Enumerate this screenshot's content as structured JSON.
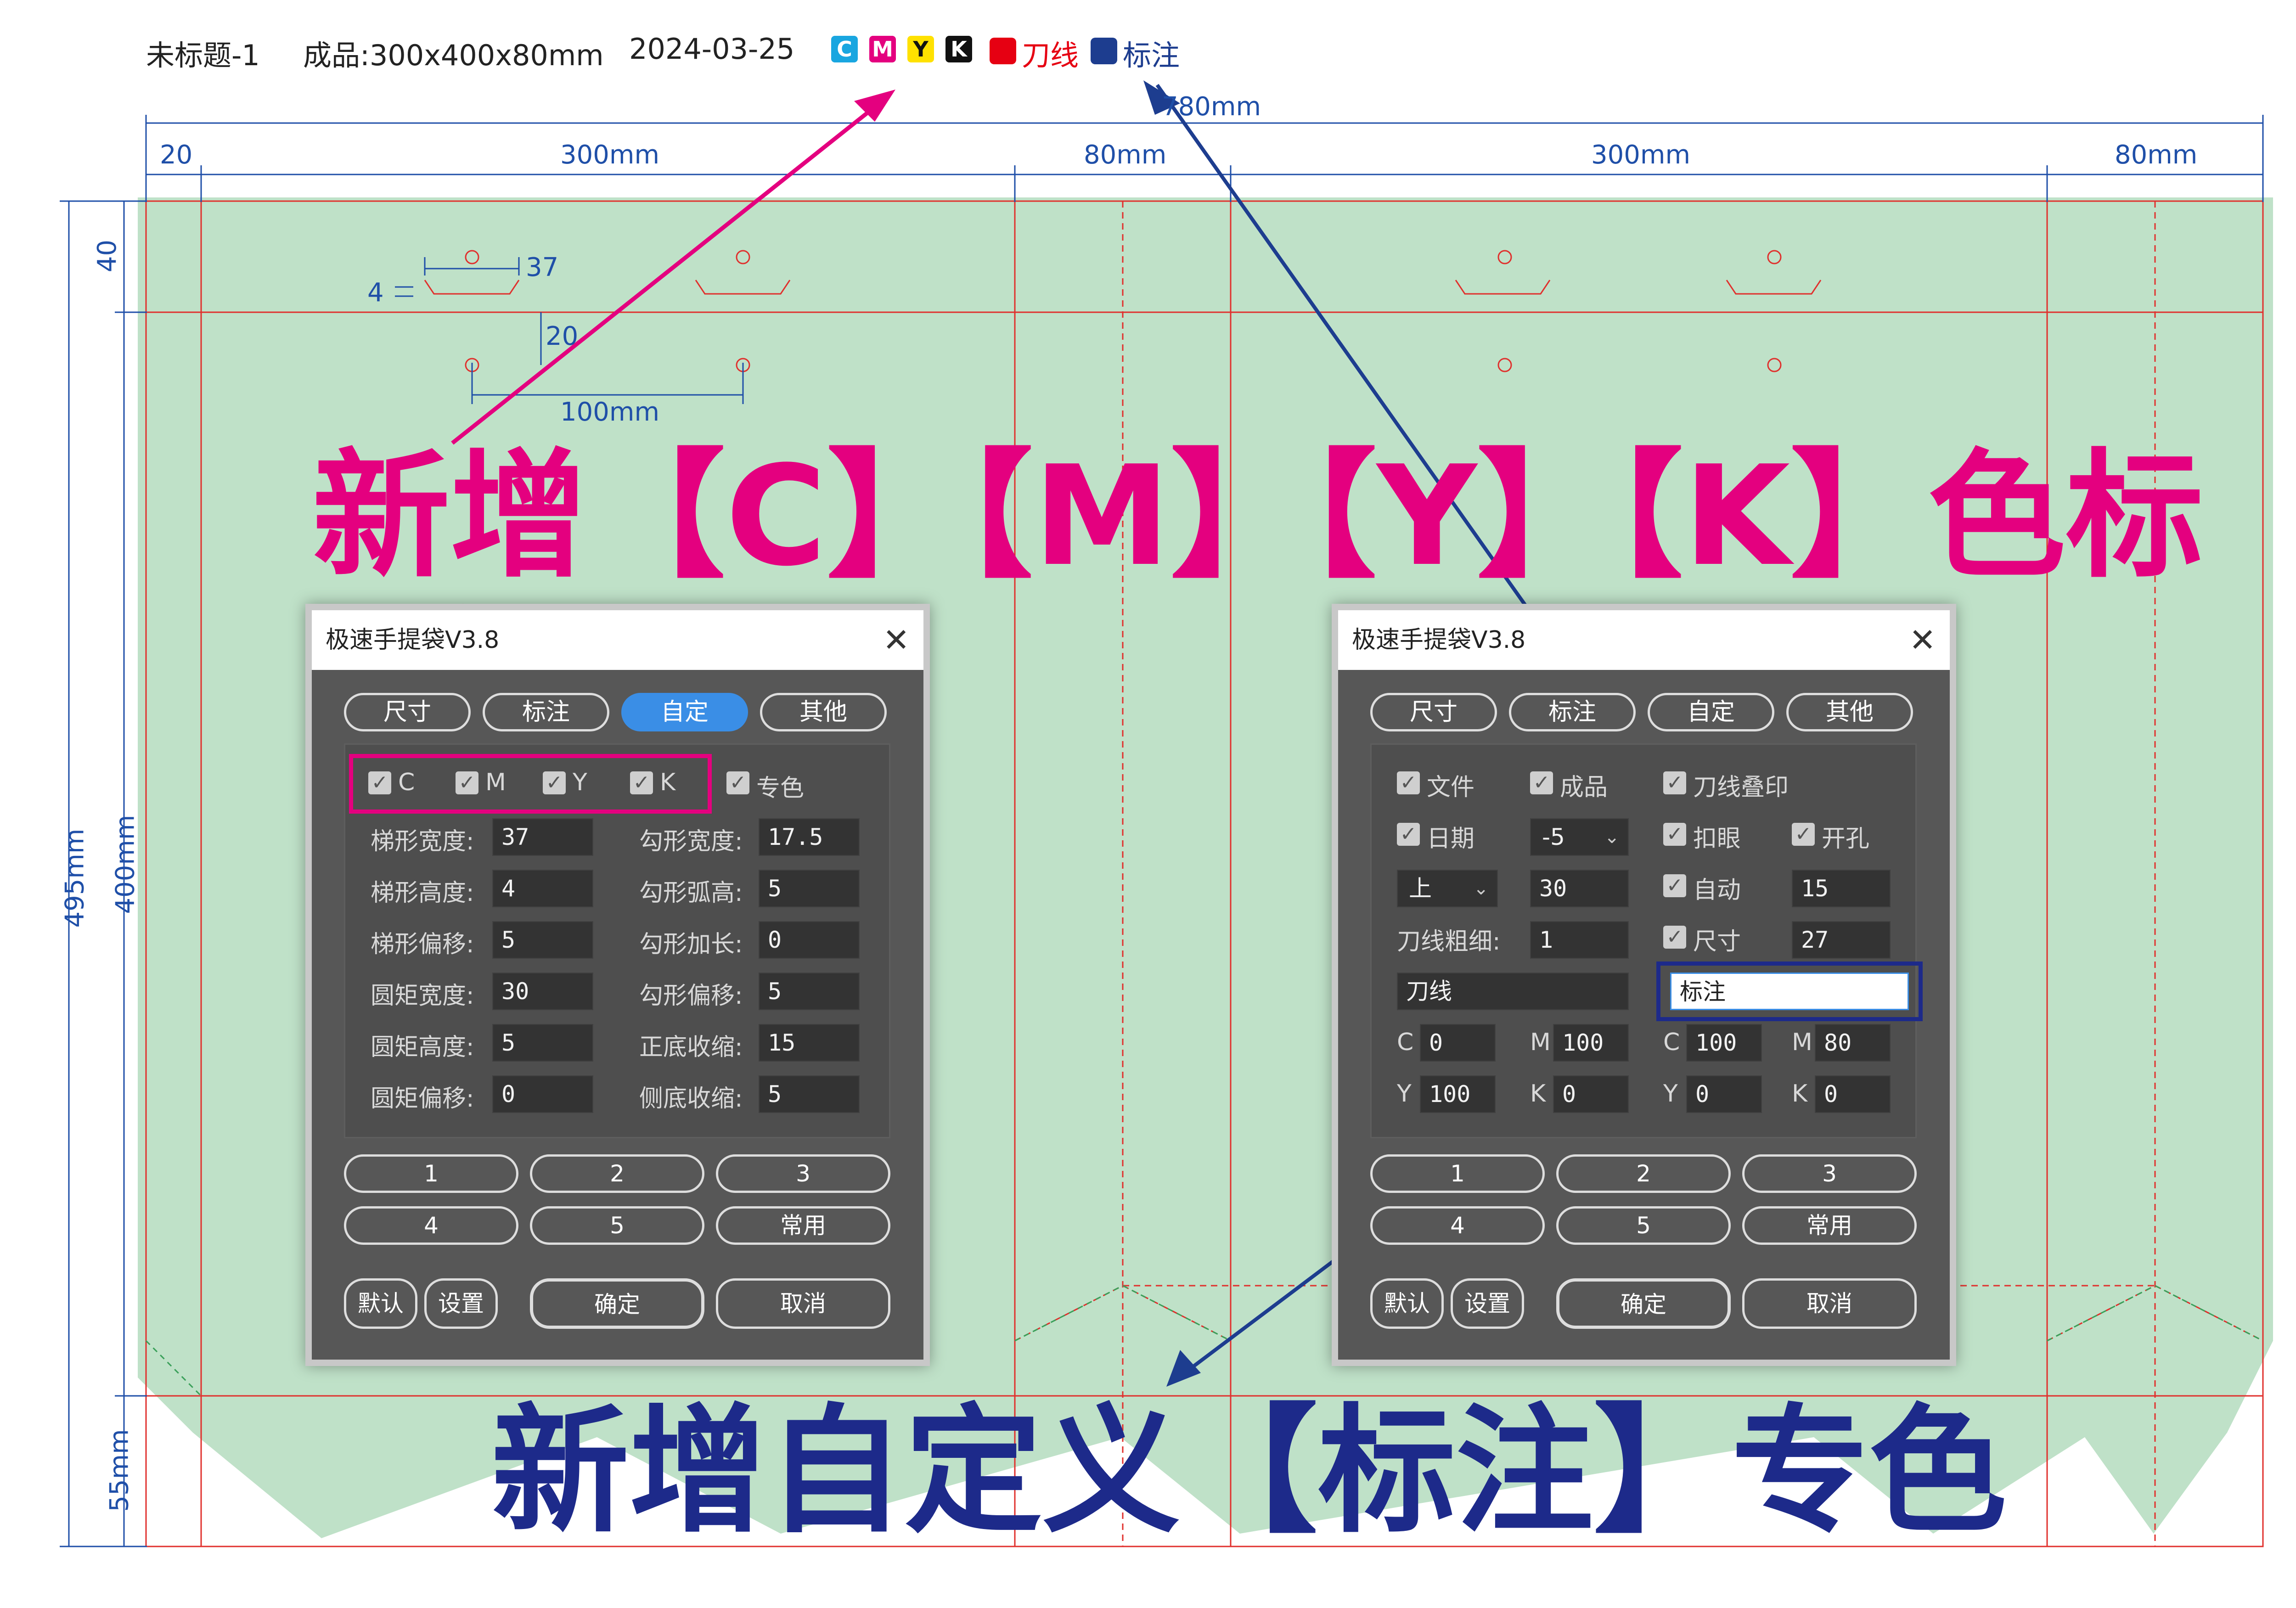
{
  "header": {
    "file_name": "未标题-1",
    "product": "成品:300x400x80mm",
    "date": "2024-03-25",
    "swatches": [
      {
        "label": "C",
        "color": "#19a6e0"
      },
      {
        "label": "M",
        "color": "#e4007f"
      },
      {
        "label": "Y",
        "color": "#ffe100"
      },
      {
        "label": "K",
        "color": "#111111"
      }
    ],
    "die_line_label": "刀线",
    "die_line_color": "#e60012",
    "annotation_label": "标注",
    "annotation_color": "#1d3d8f"
  },
  "dimensions": {
    "total_width": "780mm",
    "segments": [
      "20",
      "300mm",
      "80mm",
      "300mm",
      "80mm"
    ],
    "total_height": "495mm",
    "top": "40",
    "body": "400mm",
    "bottom": "55mm",
    "hole_detail": {
      "offset": "4",
      "width": "37",
      "height": "20",
      "spacing": "100mm"
    }
  },
  "headline_top": "新增【C】【M】【Y】【K】色标",
  "headline_bottom": "新增自定义【标注】专色",
  "colors": {
    "magenta_text": "#e4007f",
    "navy_text": "#1d2a8a",
    "bag_fill": "#bfe1c8",
    "dim_blue": "#1f4fa8",
    "die_red": "#e0302d"
  },
  "dialog_left": {
    "title": "极速手提袋V3.8",
    "close": "✕",
    "tabs": [
      "尺寸",
      "标注",
      "自定",
      "其他"
    ],
    "active_tab": "自定",
    "checks": [
      "C",
      "M",
      "Y",
      "K",
      "专色"
    ],
    "fields_left": [
      {
        "label": "梯形宽度:",
        "value": "37"
      },
      {
        "label": "梯形高度:",
        "value": "4"
      },
      {
        "label": "梯形偏移:",
        "value": "5"
      },
      {
        "label": "圆矩宽度:",
        "value": "30"
      },
      {
        "label": "圆矩高度:",
        "value": "5"
      },
      {
        "label": "圆矩偏移:",
        "value": "0"
      }
    ],
    "fields_right": [
      {
        "label": "勾形宽度:",
        "value": "17.5"
      },
      {
        "label": "勾形弧高:",
        "value": "5"
      },
      {
        "label": "勾形加长:",
        "value": "0"
      },
      {
        "label": "勾形偏移:",
        "value": "5"
      },
      {
        "label": "正底收缩:",
        "value": "15"
      },
      {
        "label": "侧底收缩:",
        "value": "5"
      }
    ],
    "presets": [
      "1",
      "2",
      "3",
      "4",
      "5",
      "常用"
    ],
    "bottom_buttons": {
      "default": "默认",
      "settings": "设置",
      "ok": "确定",
      "cancel": "取消"
    }
  },
  "dialog_right": {
    "title": "极速手提袋V3.8",
    "close": "✕",
    "tabs": [
      "尺寸",
      "标注",
      "自定",
      "其他"
    ],
    "checks": {
      "file": "文件",
      "product": "成品",
      "dieprint": "刀线叠印",
      "date": "日期",
      "button_eye": "扣眼",
      "punch": "开孔",
      "auto": "自动",
      "size": "尺寸"
    },
    "date_offset": "-5",
    "position": "上",
    "pos_value": "30",
    "auto_value": "15",
    "size_value": "27",
    "line_width_label": "刀线粗细:",
    "line_width_value": "1",
    "die_name": "刀线",
    "annotation_name": "标注",
    "die_cmyk": {
      "C": "0",
      "M": "100",
      "Y": "100",
      "K": "0"
    },
    "ann_cmyk": {
      "C": "100",
      "M": "80",
      "Y": "0",
      "K": "0"
    },
    "cmyk_labels": [
      "C",
      "M",
      "Y",
      "K"
    ],
    "presets": [
      "1",
      "2",
      "3",
      "4",
      "5",
      "常用"
    ],
    "bottom_buttons": {
      "default": "默认",
      "settings": "设置",
      "ok": "确定",
      "cancel": "取消"
    }
  }
}
